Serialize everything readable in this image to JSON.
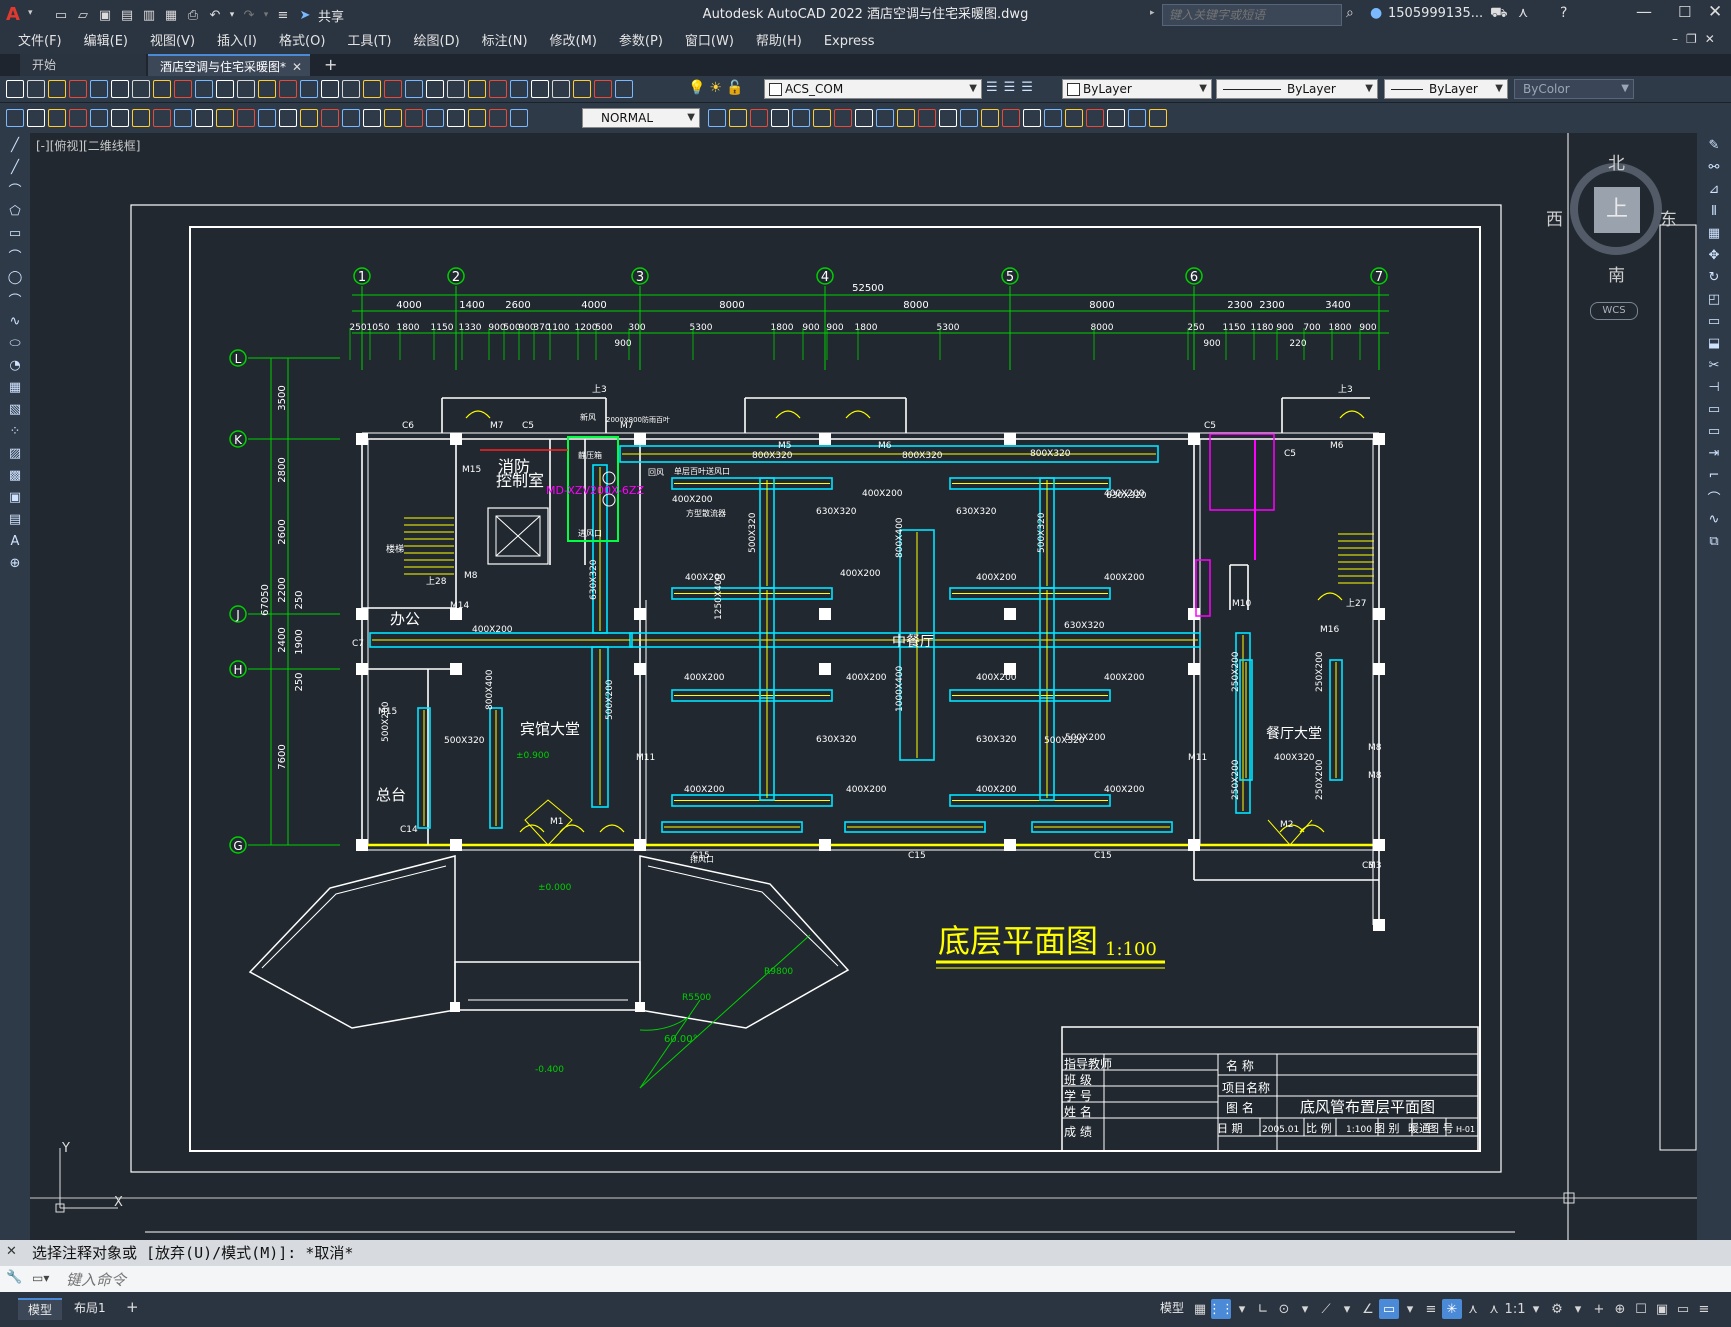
{
  "app": {
    "title": "Autodesk AutoCAD 2022    酒店空调与住宅采暖图.dwg",
    "logo": "A",
    "share_label": "共享",
    "search_placeholder": "键入关键字或短语",
    "user": "1505999135..."
  },
  "menu": [
    "文件(F)",
    "编辑(E)",
    "视图(V)",
    "插入(I)",
    "格式(O)",
    "工具(T)",
    "绘图(D)",
    "标注(N)",
    "修改(M)",
    "参数(P)",
    "窗口(W)",
    "帮助(H)",
    "Express"
  ],
  "tabs": {
    "start": "开始",
    "active": "酒店空调与住宅采暖图*"
  },
  "toolbar": {
    "layer": "ACS_COM",
    "color": "ByLayer",
    "linetype": "ByLayer",
    "lineweight": "ByLayer",
    "plotstyle": "ByColor",
    "textstyle": "NORMAL"
  },
  "view_label": "[-][俯视][二维线框]",
  "viewcube": {
    "north": "北",
    "south": "南",
    "east": "东",
    "west": "西",
    "top": "上",
    "wcs": "WCS"
  },
  "drawing": {
    "title": "底层平面图",
    "scale": "1:100",
    "grid_cols": [
      "1",
      "2",
      "3",
      "4",
      "5",
      "6",
      "7"
    ],
    "grid_rows": [
      "L",
      "K",
      "J",
      "H",
      "G"
    ],
    "total_width": "52500",
    "total_height": "67050",
    "col_spacings": [
      "4000",
      "1400",
      "2600",
      "4000",
      "8000",
      "8000",
      "8000",
      "2300",
      "2300",
      "3400"
    ],
    "sub_dims": [
      "250",
      "1050",
      "1800",
      "1150",
      "1330",
      "900",
      "500",
      "900",
      "370",
      "1100",
      "1200",
      "500",
      "300",
      "5300",
      "1800",
      "900",
      "900",
      "1800",
      "5300",
      "8000",
      "250",
      "1150",
      "1180",
      "900",
      "700",
      "1800",
      "900"
    ],
    "sub_dims2": [
      "900",
      "900",
      "220"
    ],
    "row_dims": [
      "3500",
      "2800",
      "2600",
      "2200",
      "2400",
      "1900",
      "7600"
    ],
    "row_dims2": [
      "250",
      "250"
    ],
    "rooms": [
      "消防",
      "控制室",
      "办公",
      "宾馆大堂",
      "总台",
      "中餐厅",
      "餐厅大堂",
      "楼梯"
    ],
    "duct_labels": [
      "800X320",
      "800X320",
      "800X320",
      "400X200",
      "400X200",
      "400X200",
      "400X200",
      "400X200",
      "400X200",
      "400X200",
      "400X200",
      "400X200",
      "400X200",
      "400X200",
      "400X200",
      "400X200",
      "400X200",
      "400X200",
      "400X200",
      "630X320",
      "630X320",
      "630X320",
      "630X320",
      "630X320",
      "630X320",
      "500X320",
      "500X320",
      "500X320",
      "500X320",
      "500X200",
      "500X200",
      "800X400",
      "800X400",
      "1000X400",
      "1250X400",
      "630X320",
      "500X200",
      "250X200",
      "250X200",
      "250X200",
      "250X200",
      "400X320"
    ],
    "equip_labels": [
      "静压箱",
      "新风",
      "回风",
      "MD-XZV200X-6ZZ",
      "进风口",
      "方型散流器",
      "单层百叶送风口",
      "排风口"
    ],
    "door_labels": [
      "M7",
      "M5",
      "M6",
      "M6",
      "M7",
      "M15",
      "M8",
      "M15",
      "M11",
      "M11",
      "M16",
      "M8",
      "M8",
      "M2",
      "M3",
      "M1",
      "M10",
      "M14"
    ],
    "window_labels": [
      "C6",
      "C5",
      "C5",
      "C5",
      "C15",
      "C15",
      "C15",
      "C14",
      "C7",
      "C3"
    ],
    "elevations": [
      "±0.000",
      "-0.400",
      "±0.900",
      "上3",
      "上3",
      "上28",
      "上27"
    ],
    "radius_labels": [
      "R9800",
      "R5500",
      "60.00°"
    ],
    "small_notes": [
      "2000X800防雨百叶"
    ]
  },
  "titleblock": {
    "left_labels": [
      "指导教师",
      "班  级",
      "学  号",
      "姓  名",
      "成  绩"
    ],
    "name_label": "名  称",
    "project_label": "项目名称",
    "drawing_label": "图  名",
    "drawing_name": "底风管布置层平面图",
    "date_label": "日 期",
    "date": "2005.01",
    "scale_label": "比 例",
    "scale": "1:100",
    "category_label": "图 别",
    "category": "暖通",
    "number_label": "图 号",
    "number": "H-01"
  },
  "command": {
    "history": "选择注释对象或 [放弃(U)/模式(M)]: *取消*",
    "placeholder": "键入命令"
  },
  "status": {
    "model_tab": "模型",
    "layout_tab": "布局1",
    "model_btn": "模型",
    "scale": "1:1"
  },
  "colors": {
    "bg": "#212830",
    "grid": "#00d000",
    "wall": "#ffffff",
    "duct": "#00e5ff",
    "highlight": "#ffff00",
    "magenta": "#ff00ff",
    "red": "#ff2020"
  }
}
